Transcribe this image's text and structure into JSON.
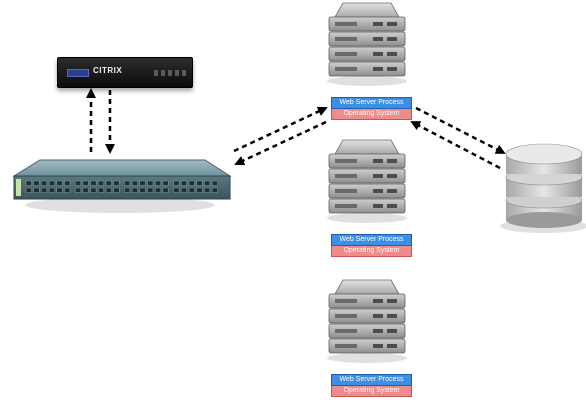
{
  "appliance": {
    "brand": "CITRIX"
  },
  "servers": [
    {
      "web_label": "Web Server Process",
      "os_label": "Operating System"
    },
    {
      "web_label": "Web Server Process",
      "os_label": "Operating System"
    },
    {
      "web_label": "Web Server Process",
      "os_label": "Operating System"
    }
  ],
  "colors": {
    "web_process": "#3c8fe6",
    "operating_system": "#ef8b8b",
    "server_body": "#9a9a9a",
    "switch_body": "#5c7f8a"
  }
}
